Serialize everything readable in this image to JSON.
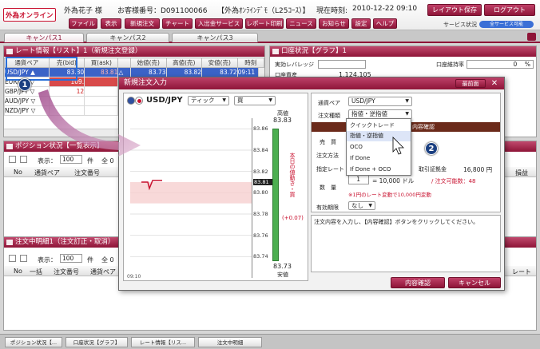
{
  "header": {
    "logo": "外為オンライン",
    "user_name": "外為花子 様",
    "customer_no_label": "お客様番号：D091100066",
    "account_label": "【外為ｵﾝﾗｲﾝﾃﾞﾓ（L25ｺｰｽ）】",
    "time_label": "現在時刻:",
    "time_value": "2010-12-22 09:10",
    "layout_save": "レイアウト保存",
    "logout": "ログアウト",
    "nav": [
      "ファイル",
      "表示",
      "新規注文",
      "チャート",
      "入出金サービス",
      "レポート印刷",
      "ニュース",
      "お知らせ",
      "設定",
      "ヘルプ"
    ],
    "service_label": "サービス状況",
    "service_status": "全サービス可能"
  },
  "tabs": [
    "キャンパス1",
    "キャンパス2",
    "キャンパス3"
  ],
  "rate_panel": {
    "title": "レート情報【リスト】1（新規注文登録）",
    "columns": [
      "通貨ペア",
      "売(bid)",
      "買(ask)",
      "",
      "始値(売)",
      "高値(売)",
      "安値(売)",
      "時刻"
    ],
    "rows": [
      {
        "pair": "USD/JPY",
        "arrow": "▲",
        "bid": "83.80",
        "ask": "83.81",
        "mark": "△",
        "open": "83.73",
        "high": "83.82",
        "low": "83.72",
        "time": "09:11"
      },
      {
        "pair": "EUR/JPY",
        "arrow": "▽",
        "bid": "109.",
        "ask": "",
        "mark": "",
        "open": "",
        "high": "",
        "low": "",
        "time": ""
      },
      {
        "pair": "GBP/JPY",
        "arrow": "▽",
        "bid": "12",
        "ask": "",
        "mark": "",
        "open": "",
        "high": "",
        "low": "",
        "time": ""
      },
      {
        "pair": "AUD/JPY",
        "arrow": "▽",
        "bid": "",
        "ask": "",
        "mark": "",
        "open": "",
        "high": "",
        "low": "",
        "time": ""
      },
      {
        "pair": "NZD/JPY",
        "arrow": "▽",
        "bid": "",
        "ask": "",
        "mark": "",
        "open": "",
        "high": "",
        "low": "",
        "time": ""
      }
    ]
  },
  "account_panel": {
    "title": "口座状況【グラフ】1",
    "leverage_label": "実効レバレッジ",
    "maintenance_label": "口座維持率",
    "pct": "%",
    "zero": "0",
    "assets_label": "口座資産",
    "assets_value": "1,124,105"
  },
  "position_panel": {
    "title": "ポジション状況【一覧表示】",
    "display_label": "表示：",
    "display_value": "100",
    "count_suffix": "件",
    "total_label": "全 0",
    "columns": [
      "No",
      "通貨ペア",
      "注文番号"
    ],
    "right_col": "損益"
  },
  "order_panel": {
    "title": "注文中明細1（注文訂正・取消）",
    "display_label": "表示：",
    "display_value": "100",
    "count_suffix": "件",
    "total_label": "全 0",
    "columns": [
      "No",
      "一括",
      "注文番号",
      "通貨ペア"
    ],
    "right_col": "レート"
  },
  "modal": {
    "title": "新規注文入力",
    "pin_label": "最前面",
    "pair": "USD/JPY",
    "chart_type": "ティック",
    "side_select": "買",
    "high_label": "高値",
    "high_value": "83.83",
    "low_value": "83.73",
    "low_label": "安値",
    "y_ticks": [
      "83.86",
      "83.84",
      "83.82",
      "83.81",
      "83.80",
      "83.78",
      "83.76",
      "83.74"
    ],
    "current_price": "83.81",
    "change_text": "本日の値動き・買",
    "change_value": "(+0.07)",
    "chart_time": "09:10",
    "pair_label": "通貨ペア",
    "pair_select": "USD/JPY",
    "order_type_label": "注文種類",
    "order_type_value": "指値・逆指値",
    "confirm_header": "内容確認",
    "side_label": "売　買",
    "method_label": "注文方法",
    "limit_label": "指定レート",
    "amount_label": "数　量",
    "amount_value": "1",
    "amount_unit": "= 10,000 ドル",
    "margin_label": "取引証拠金",
    "margin_value": "16,800 円",
    "available_label": "/ 注文可能数：48",
    "note": "※1円のレート変動で10,000円変動",
    "expiry_label": "有効期限",
    "expiry_value": "なし",
    "message": "注文内容を入力し、【内容確認】ボタンをクリックしてください。",
    "confirm_button": "内容確認",
    "cancel_button": "キャンセル"
  },
  "dropdown": {
    "options": [
      "クイックトレード",
      "指値・逆指値",
      "OCO",
      "If Done",
      "If Done + OCO"
    ],
    "selected": "指値・逆指値"
  },
  "badges": [
    "1",
    "2"
  ],
  "bottom_tabs": [
    "ポジション状況【...",
    "口座状況【グラフ】",
    "レート情報【リス...",
    "注文中明細"
  ],
  "chart_data": {
    "type": "line",
    "title": "",
    "x": [
      "09:10"
    ],
    "series": [
      {
        "values": [
          83.81
        ]
      }
    ],
    "ylim": [
      83.72,
      83.87
    ],
    "yticks": [
      83.86,
      83.84,
      83.82,
      83.8,
      83.78,
      83.76,
      83.74
    ],
    "current": 83.81,
    "day_high": 83.83,
    "day_low": 83.73
  },
  "colors": {
    "brand": "#8e1538",
    "selection": "#3b63c7",
    "bid": "#2049c7",
    "ask": "#d02020"
  }
}
